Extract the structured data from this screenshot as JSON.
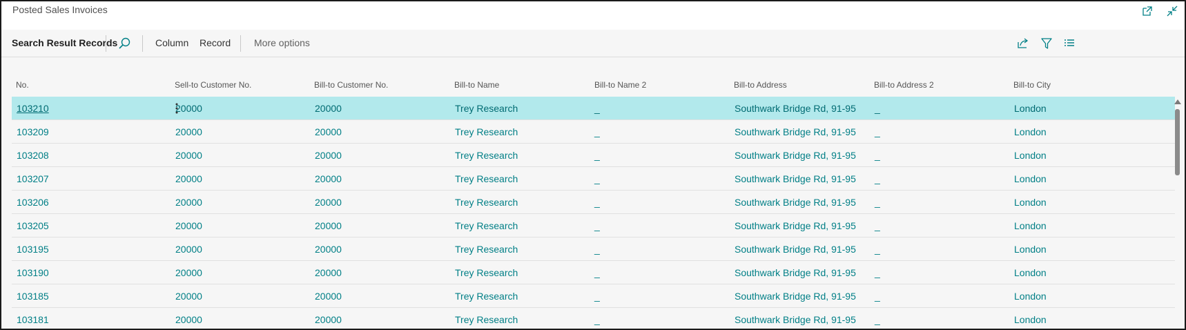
{
  "window": {
    "title": "Posted Sales Invoices"
  },
  "toolbar": {
    "search_results_label": "Search Result Records",
    "column_label": "Column",
    "record_label": "Record",
    "more_options_label": "More options"
  },
  "columns": [
    "No.",
    "Sell-to Customer No.",
    "Bill-to Customer No.",
    "Bill-to Name",
    "Bill-to Name 2",
    "Bill-to Address",
    "Bill-to Address 2",
    "Bill-to City"
  ],
  "rows": [
    [
      "103210",
      "20000",
      "20000",
      "Trey Research",
      "_",
      "Southwark Bridge Rd, 91-95",
      "_",
      "London"
    ],
    [
      "103209",
      "20000",
      "20000",
      "Trey Research",
      "_",
      "Southwark Bridge Rd, 91-95",
      "_",
      "London"
    ],
    [
      "103208",
      "20000",
      "20000",
      "Trey Research",
      "_",
      "Southwark Bridge Rd, 91-95",
      "_",
      "London"
    ],
    [
      "103207",
      "20000",
      "20000",
      "Trey Research",
      "_",
      "Southwark Bridge Rd, 91-95",
      "_",
      "London"
    ],
    [
      "103206",
      "20000",
      "20000",
      "Trey Research",
      "_",
      "Southwark Bridge Rd, 91-95",
      "_",
      "London"
    ],
    [
      "103205",
      "20000",
      "20000",
      "Trey Research",
      "_",
      "Southwark Bridge Rd, 91-95",
      "_",
      "London"
    ],
    [
      "103195",
      "20000",
      "20000",
      "Trey Research",
      "_",
      "Southwark Bridge Rd, 91-95",
      "_",
      "London"
    ],
    [
      "103190",
      "20000",
      "20000",
      "Trey Research",
      "_",
      "Southwark Bridge Rd, 91-95",
      "_",
      "London"
    ],
    [
      "103185",
      "20000",
      "20000",
      "Trey Research",
      "_",
      "Southwark Bridge Rd, 91-95",
      "_",
      "London"
    ],
    [
      "103181",
      "20000",
      "20000",
      "Trey Research",
      "_",
      "Southwark Bridge Rd, 91-95",
      "_",
      "London"
    ]
  ],
  "selected_row": 0,
  "icons": {
    "open_new_window": "open-in-new-window-icon",
    "collapse": "collapse-icon",
    "search": "search-icon",
    "share": "share-icon",
    "filter": "filter-icon",
    "list_view": "list-view-icon",
    "row_actions": "more-vertical-icon"
  },
  "colors": {
    "accent": "#007f86",
    "selected_row": "#b2e9ec"
  }
}
